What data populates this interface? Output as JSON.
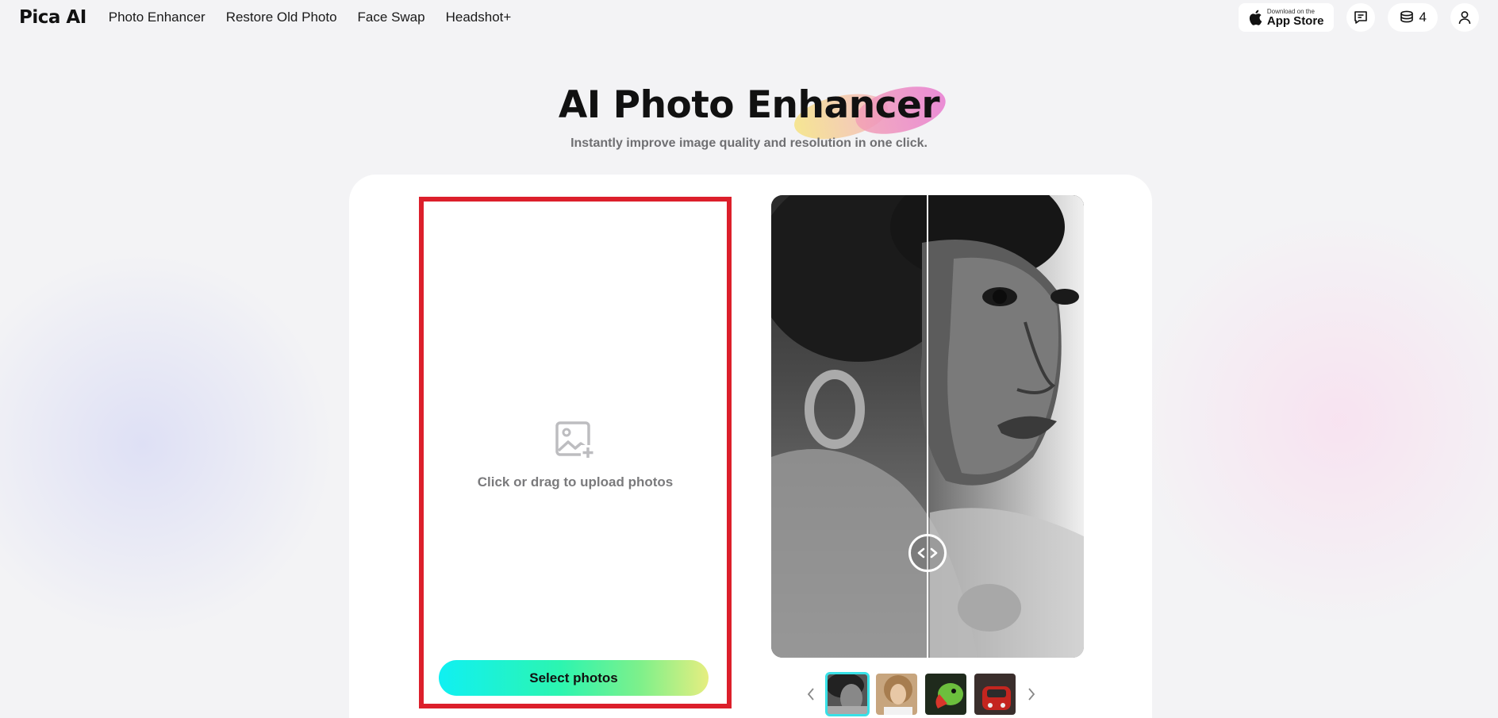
{
  "header": {
    "logo": "Pica AI",
    "nav": [
      "Photo Enhancer",
      "Restore Old Photo",
      "Face Swap",
      "Headshot+"
    ],
    "app_store_small": "Download on the",
    "app_store_big": "App Store",
    "credits": "4"
  },
  "hero": {
    "title": "AI Photo Enhancer",
    "subtitle": "Instantly improve image quality and resolution in one click."
  },
  "upload": {
    "prompt": "Click or drag to upload photos",
    "button_label": "Select photos"
  },
  "colors": {
    "highlight_border": "#dc1f2b",
    "button_gradient_start": "#10f0f2",
    "button_gradient_end": "#e6ee80",
    "active_thumb": "#38e0e6"
  },
  "carousel": {
    "thumbnails": [
      "portrait-woman-bw",
      "portrait-woman-blonde",
      "parrot",
      "red-car"
    ],
    "active_index": 0
  }
}
